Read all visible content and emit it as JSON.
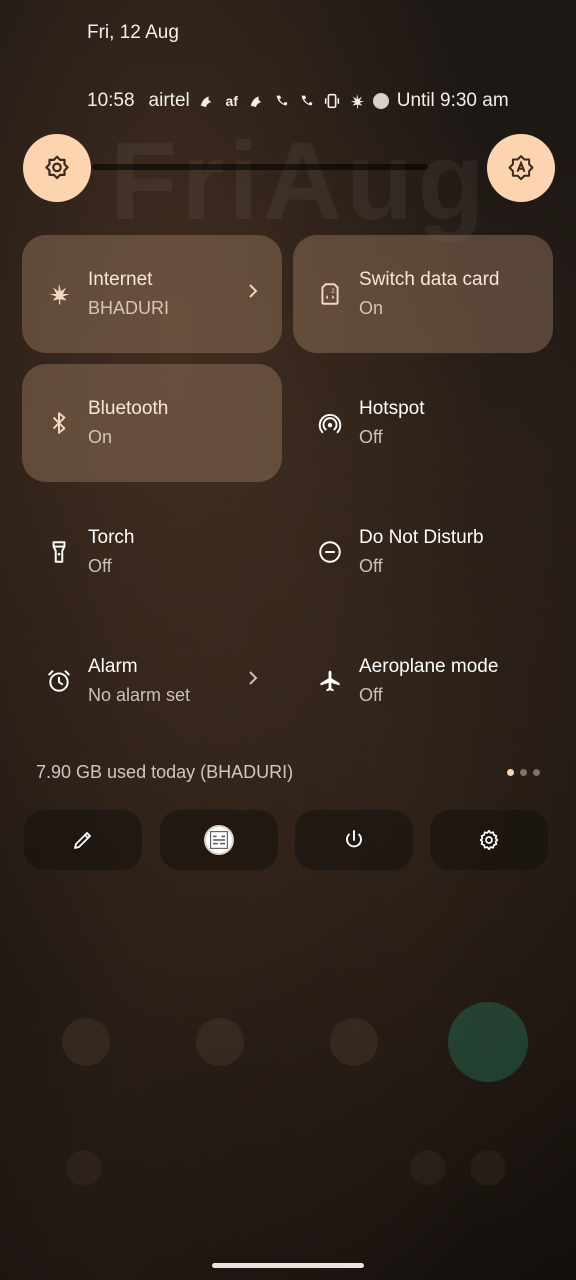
{
  "header": {
    "date": "Fri, 12 Aug",
    "status": {
      "time": "10:58",
      "carrier": "airtel",
      "alarm_until": "Until 9:30 am"
    }
  },
  "tiles": [
    {
      "title": "Internet",
      "subtitle": "BHADURI",
      "state": "on",
      "icon": "cannabis-leaf-icon",
      "has_chevron": true
    },
    {
      "title": "Switch data card",
      "subtitle": "On",
      "state": "on",
      "icon": "sim-card-icon"
    },
    {
      "title": "Bluetooth",
      "subtitle": "On",
      "state": "on",
      "icon": "bluetooth-icon"
    },
    {
      "title": "Hotspot",
      "subtitle": "Off",
      "state": "off",
      "icon": "hotspot-icon"
    },
    {
      "title": "Torch",
      "subtitle": "Off",
      "state": "off",
      "icon": "flashlight-icon"
    },
    {
      "title": "Do Not Disturb",
      "subtitle": "Off",
      "state": "off",
      "icon": "do-not-disturb-icon"
    },
    {
      "title": "Alarm",
      "subtitle": "No alarm set",
      "state": "off",
      "icon": "alarm-clock-icon",
      "has_chevron": true
    },
    {
      "title": "Aeroplane mode",
      "subtitle": "Off",
      "state": "off",
      "icon": "airplane-icon"
    }
  ],
  "data_usage": "7.90 GB used today (BHADURI)",
  "pagination": {
    "pages": 3,
    "current": 1
  },
  "bottom_actions": [
    {
      "icon": "edit-pencil-icon"
    },
    {
      "icon": "user-avatar-icon"
    },
    {
      "icon": "power-icon"
    },
    {
      "icon": "settings-gear-icon"
    }
  ],
  "colors": {
    "accent": "#fdd4b0",
    "tile_on": "#9c7a62",
    "background": "#1c1714"
  }
}
